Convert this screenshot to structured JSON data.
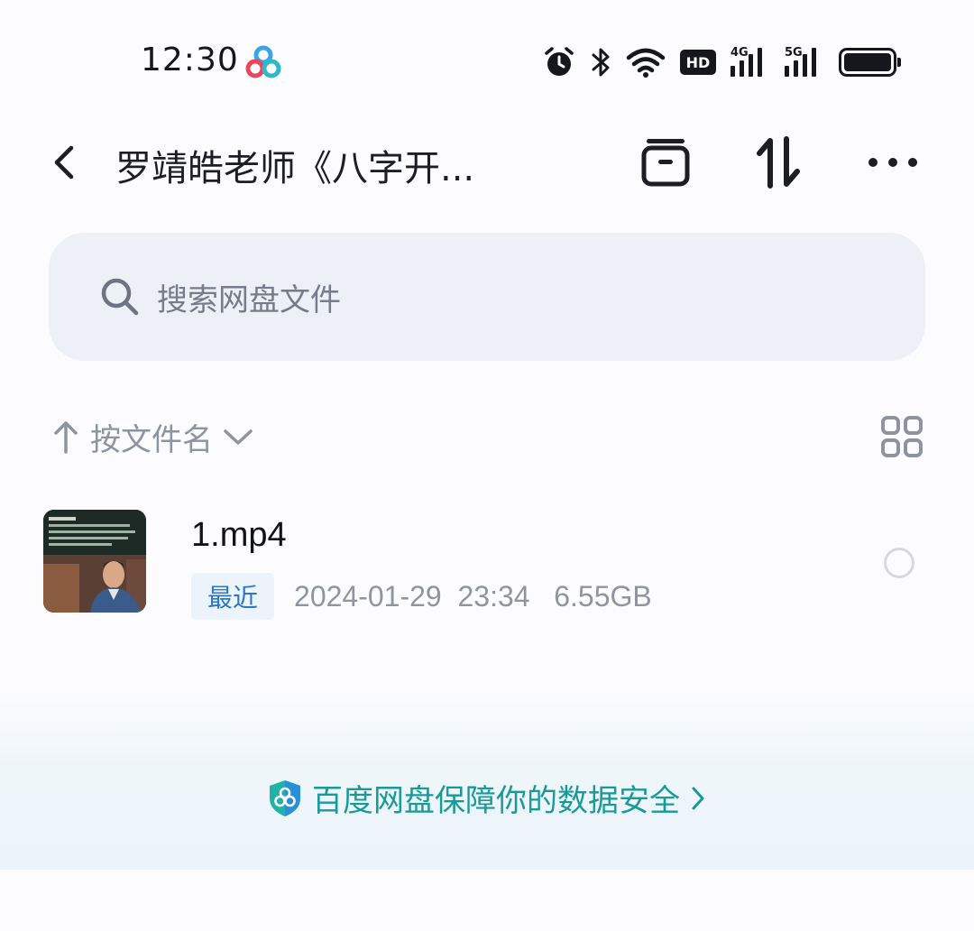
{
  "status_bar": {
    "time": "12:30",
    "hd_label": "HD",
    "network_1": "4G",
    "network_2": "5G"
  },
  "header": {
    "title": "罗靖皓老师《八字开..."
  },
  "search": {
    "placeholder": "搜索网盘文件"
  },
  "sort": {
    "label": "按文件名"
  },
  "files": [
    {
      "name": "1.mp4",
      "badge": "最近",
      "meta": "2024-01-29  23:34   6.55GB"
    }
  ],
  "footer": {
    "security_text": "百度网盘保障你的数据安全"
  },
  "colors": {
    "accent_teal": "#179a9a",
    "badge_blue": "#2a76c9",
    "search_bg": "#eef0f7",
    "text_gray": "#8f949f"
  },
  "icons": {
    "back": "chevron-left-icon",
    "archive": "archive-box-icon",
    "sort_toggle": "sort-arrows-icon",
    "more": "more-dots-icon",
    "search": "search-icon",
    "grid": "grid-view-icon",
    "shield": "shield-icon"
  }
}
